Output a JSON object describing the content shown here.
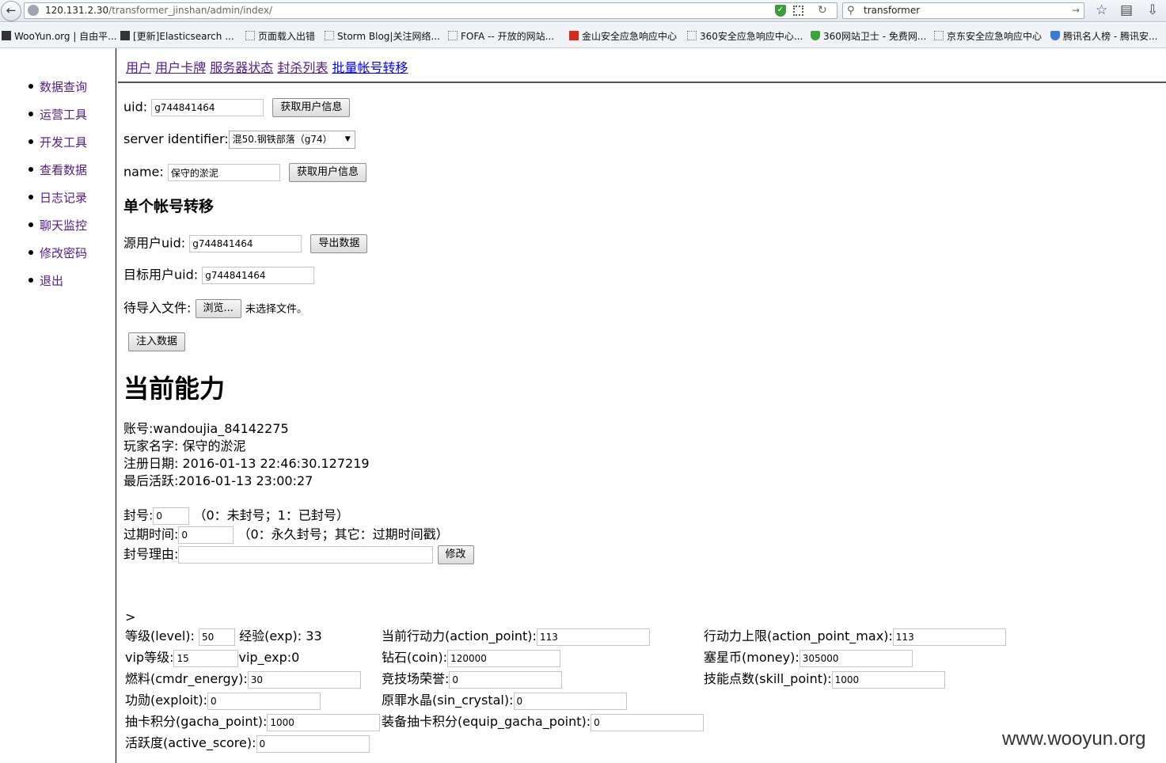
{
  "browser": {
    "url_host": "120.131.2.30",
    "url_path": "/transformer_jinshan/admin/index/",
    "search_query": "transformer",
    "bookmarks": [
      {
        "label": "WooYun.org | 自由平...",
        "icon": "wooyun-icon"
      },
      {
        "label": "[更新]Elasticsearch ...",
        "icon": "elastic-icon"
      },
      {
        "label": "页面载入出错",
        "icon": "blank-page-icon"
      },
      {
        "label": "Storm Blog|关注网络...",
        "icon": "blank-page-icon"
      },
      {
        "label": "FOFA -- 开放的网站...",
        "icon": "blank-page-icon"
      },
      {
        "label": "金山安全应急响应中心",
        "icon": "kingsoft-icon"
      },
      {
        "label": "360安全应急响应中心...",
        "icon": "blank-page-icon"
      },
      {
        "label": "360网站卫士 - 免费网...",
        "icon": "shield-green-icon"
      },
      {
        "label": "京东安全应急响应中心",
        "icon": "blank-page-icon"
      },
      {
        "label": "腾讯名人榜 - 腾讯安...",
        "icon": "shield-blue-icon"
      }
    ]
  },
  "sidebar": {
    "items": [
      "数据查询",
      "运营工具",
      "开发工具",
      "查看数据",
      "日志记录",
      "聊天监控",
      "修改密码",
      "退出"
    ]
  },
  "topnav": {
    "links": [
      "用户",
      "用户卡牌",
      "服务器状态",
      "封杀列表",
      "批量帐号转移"
    ]
  },
  "lookup": {
    "uid_label": "uid:",
    "uid_value": "g744841464",
    "fetch_button": "获取用户信息",
    "server_label": "server identifier:",
    "server_value": "混50.钢铁部落（g74）",
    "name_label": "name:",
    "name_value": "保守的淤泥"
  },
  "transfer": {
    "heading": "单个帐号转移",
    "source_label": "源用户uid:",
    "source_value": "g744841464",
    "export_button": "导出数据",
    "target_label": "目标用户uid:",
    "target_value": "g744841464",
    "file_label": "待导入文件:",
    "browse_button": "浏览...",
    "no_file": "未选择文件。",
    "inject_button": "注入数据"
  },
  "ability": {
    "heading": "当前能力",
    "account": "账号:wandoujia_84142275",
    "player_name": "玩家名字: 保守的淤泥",
    "register_date": "注册日期: 2016-01-13 22:46:30.127219",
    "last_active": "最后活跃:2016-01-13 23:00:27"
  },
  "ban": {
    "ban_label": "封号:",
    "ban_value": "0",
    "ban_hint": "（0：未封号；1：已封号）",
    "expire_label": "过期时间:",
    "expire_value": "0",
    "expire_hint": "（0：永久封号；其它：过期时间戳）",
    "reason_label": "封号理由:",
    "reason_value": "",
    "modify_button": "修改"
  },
  "stats": {
    "marker": ">",
    "level_label": "等级(level):",
    "level_value": "50",
    "exp_text": "经验(exp): 33",
    "action_point_label": "当前行动力(action_point):",
    "action_point_value": "113",
    "action_point_max_label": "行动力上限(action_point_max):",
    "action_point_max_value": "113",
    "vip_label": "vip等级:",
    "vip_value": "15",
    "vip_exp_text": "vip_exp:0",
    "coin_label": "钻石(coin):",
    "coin_value": "120000",
    "money_label": "塞星币(money):",
    "money_value": "305000",
    "cmdr_energy_label": "燃料(cmdr_energy):",
    "cmdr_energy_value": "30",
    "arena_label": "竞技场荣誉:",
    "arena_value": "0",
    "skill_point_label": "技能点数(skill_point):",
    "skill_point_value": "1000",
    "exploit_label": "功勋(exploit):",
    "exploit_value": "0",
    "sin_crystal_label": "原罪水晶(sin_crystal):",
    "sin_crystal_value": "0",
    "gacha_label": "抽卡积分(gacha_point):",
    "gacha_value": "1000",
    "equip_gacha_label": "装备抽卡积分(equip_gacha_point):",
    "equip_gacha_value": "0",
    "active_score_label": "活跃度(active_score):",
    "active_score_value": "0"
  },
  "watermark": "www.wooyun.org"
}
